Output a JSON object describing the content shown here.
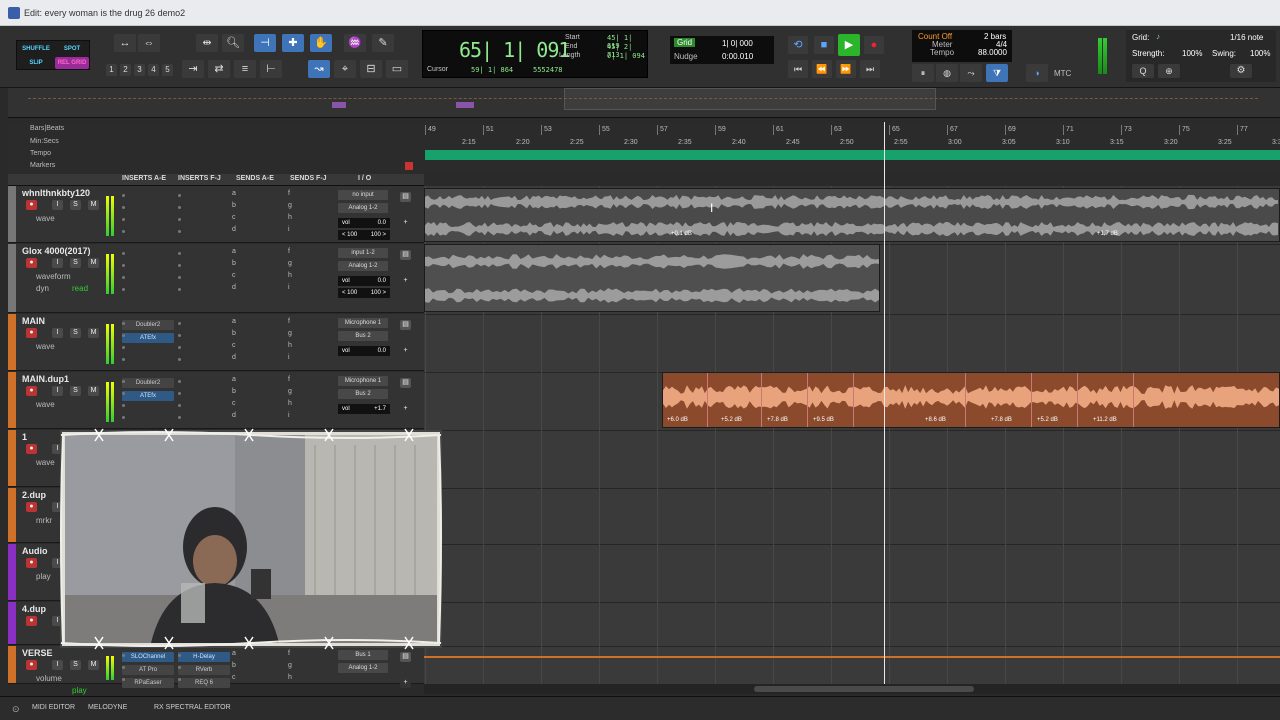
{
  "window": {
    "title": "Edit: every woman is the drug 26 demo2"
  },
  "toolbar": {
    "modes": [
      "SHUFFLE",
      "SPOT",
      "SLIP",
      "REL GRID"
    ],
    "zoom_presets": [
      "1",
      "2",
      "3",
      "4",
      "5"
    ],
    "counter": {
      "main": "65| 1| 091",
      "start_label": "Start",
      "start": "45| 1| 619",
      "end_label": "End",
      "end": "45| 2| 713",
      "length_label": "Length",
      "length": "0| 1| 094",
      "cursor_label": "Cursor",
      "cursor": "59| 1| 864",
      "cursor_samples": "5552478"
    },
    "grid": {
      "label": "Grid",
      "value": "1| 0| 000"
    },
    "nudge": {
      "label": "Nudge",
      "value": "0:00.010"
    },
    "tempo": {
      "count": "Count Off",
      "bars": "2 bars",
      "meter_label": "Meter",
      "meter": "4/4",
      "tempo_label": "Tempo",
      "tempo": "88.0000"
    },
    "mtc": "MTC",
    "right": {
      "grid_label": "Grid:",
      "grid_value": "1/16 note",
      "strength_label": "Strength:",
      "strength": "100%",
      "swing_label": "Swing:",
      "swing": "100%"
    }
  },
  "rulers": {
    "names": [
      "Bars|Beats",
      "Min:Secs",
      "Tempo",
      "Markers"
    ],
    "bars": [
      "49",
      "51",
      "53",
      "55",
      "57",
      "59",
      "61",
      "63",
      "65",
      "67",
      "69",
      "71",
      "73",
      "75",
      "77"
    ],
    "times": [
      "2:15",
      "2:20",
      "2:25",
      "2:30",
      "2:35",
      "2:40",
      "2:45",
      "2:50",
      "2:55",
      "3:00",
      "3:05",
      "3:10",
      "3:15",
      "3:20",
      "3:25",
      "3:30"
    ]
  },
  "columns": [
    "INSERTS A-E",
    "INSERTS F-J",
    "SENDS A-E",
    "SENDS F-J",
    "I / O"
  ],
  "tracks": [
    {
      "name": "whnlthnkbty120",
      "color": "#777777",
      "input": "no input",
      "output": "Analog 1-2",
      "vol": "vol",
      "vol_value": "0.0",
      "pan_l": "< 100",
      "pan_r": "100 >",
      "mode": "wave",
      "inserts": []
    },
    {
      "name": "Glox 4000(2017)",
      "color": "#777777",
      "input": "input 1-2",
      "output": "Analog 1-2",
      "vol": "vol",
      "vol_value": "0.0",
      "pan_l": "< 100",
      "pan_r": "100 >",
      "mode": "waveform",
      "auto": "read",
      "dyn": "dyn",
      "inserts": []
    },
    {
      "name": "MAIN",
      "color": "#d0712a",
      "input": "Microphone 1",
      "output": "Bus 2",
      "vol": "vol",
      "vol_value": "0.0",
      "mode": "wave",
      "inserts": [
        "Doubler2",
        "ATEfx"
      ]
    },
    {
      "name": "MAIN.dup1",
      "color": "#d0712a",
      "input": "Microphone 1",
      "output": "Bus 2",
      "vol": "vol",
      "vol_value": "+1.7",
      "mode": "wave",
      "inserts": [
        "Doubler2",
        "ATEfx"
      ]
    },
    {
      "name": "1",
      "color": "#d0712a",
      "mode": "wave"
    },
    {
      "name": "2.dup",
      "color": "#d0712a",
      "mode": "mrkr"
    },
    {
      "name": "Audio",
      "color": "#8a2fc4",
      "mode": "play"
    },
    {
      "name": "4.dup",
      "color": "#8a2fc4",
      "mode": ""
    },
    {
      "name": "VERSE",
      "color": "#d0712a",
      "input": "Bus 1",
      "output": "Analog 1-2",
      "mode": "volume",
      "auto": "play",
      "inserts": [
        "SLOChannel",
        "AT Pro",
        "RPaEaser"
      ],
      "inserts_fj": [
        "H-Delay",
        "RVerb",
        "REQ 6"
      ]
    }
  ],
  "clip_gains": {
    "track1": [
      "+0.1 dB",
      "+1.7 dB"
    ],
    "main_dup": [
      "+6.0 dB",
      "+5.2 dB",
      "+7.8 dB",
      "+9.5 dB",
      "+8.6 dB",
      "+7.8 dB",
      "+5.2 dB",
      "+11.2 dB"
    ]
  },
  "send_letters": [
    "a",
    "b",
    "c",
    "d",
    "e",
    "f",
    "g",
    "h",
    "i",
    "j"
  ],
  "bottom_tabs": [
    "MIDI EDITOR",
    "MELODYNE",
    "RX SPECTRAL EDITOR"
  ]
}
